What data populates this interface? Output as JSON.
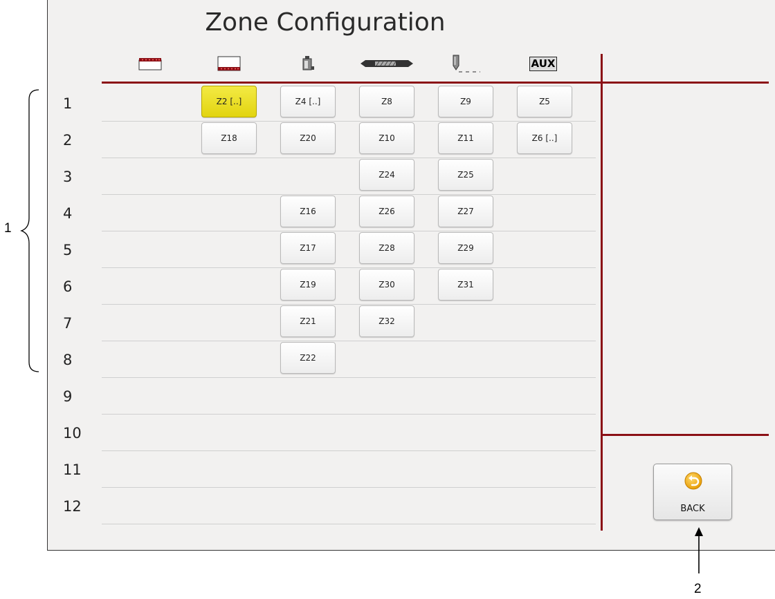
{
  "title": "Zone Configuration",
  "header_icons": [
    "hot-runner-top-icon",
    "hot-runner-bottom-icon",
    "nozzle-body-icon",
    "manifold-cartridge-icon",
    "nozzle-tip-icon",
    "aux-icon"
  ],
  "aux_label": "AUX",
  "rows": [
    "1",
    "2",
    "3",
    "4",
    "5",
    "6",
    "7",
    "8",
    "9",
    "10",
    "11",
    "12"
  ],
  "zones": [
    {
      "label": "Z2 [..]",
      "row": 1,
      "col": 2,
      "selected": true
    },
    {
      "label": "Z4 [..]",
      "row": 1,
      "col": 3
    },
    {
      "label": "Z8",
      "row": 1,
      "col": 4
    },
    {
      "label": "Z9",
      "row": 1,
      "col": 5
    },
    {
      "label": "Z5",
      "row": 1,
      "col": 6
    },
    {
      "label": "Z18",
      "row": 2,
      "col": 2
    },
    {
      "label": "Z20",
      "row": 2,
      "col": 3
    },
    {
      "label": "Z10",
      "row": 2,
      "col": 4
    },
    {
      "label": "Z11",
      "row": 2,
      "col": 5
    },
    {
      "label": "Z6 [..]",
      "row": 2,
      "col": 6
    },
    {
      "label": "Z24",
      "row": 3,
      "col": 4
    },
    {
      "label": "Z25",
      "row": 3,
      "col": 5
    },
    {
      "label": "Z16",
      "row": 4,
      "col": 3
    },
    {
      "label": "Z26",
      "row": 4,
      "col": 4
    },
    {
      "label": "Z27",
      "row": 4,
      "col": 5
    },
    {
      "label": "Z17",
      "row": 5,
      "col": 3
    },
    {
      "label": "Z28",
      "row": 5,
      "col": 4
    },
    {
      "label": "Z29",
      "row": 5,
      "col": 5
    },
    {
      "label": "Z19",
      "row": 6,
      "col": 3
    },
    {
      "label": "Z30",
      "row": 6,
      "col": 4
    },
    {
      "label": "Z31",
      "row": 6,
      "col": 5
    },
    {
      "label": "Z21",
      "row": 7,
      "col": 3
    },
    {
      "label": "Z32",
      "row": 7,
      "col": 4
    },
    {
      "label": "Z22",
      "row": 8,
      "col": 3
    }
  ],
  "back_button": {
    "label": "BACK"
  },
  "annotations": {
    "bracket_label": "1",
    "arrow_label": "2"
  },
  "colors": {
    "accent_red": "#8b1016",
    "selected_yellow": "#e9dc1f"
  }
}
